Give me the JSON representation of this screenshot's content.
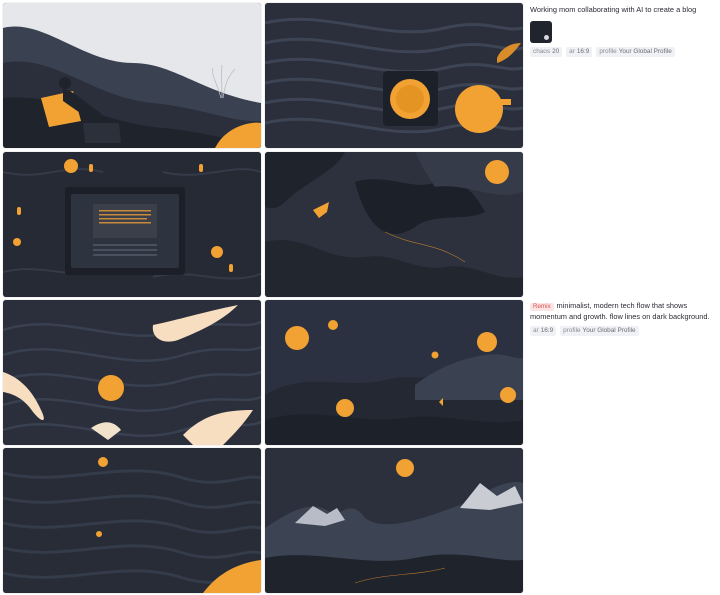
{
  "job1": {
    "prompt": "Working mom collaborating with AI to create a blog",
    "params": [
      {
        "key": "chaos",
        "value": "20"
      },
      {
        "key": "ar",
        "value": "16:9"
      },
      {
        "key": "profile",
        "value": "Your Global Profile"
      }
    ]
  },
  "job2": {
    "badge": "Remix",
    "prompt": "minimalist, modern tech flow that shows momentum and growth. flow lines on dark background.",
    "params": [
      {
        "key": "ar",
        "value": "16:9"
      },
      {
        "key": "profile",
        "value": "Your Global Profile"
      }
    ]
  },
  "colors": {
    "dark": "#2a2f3b",
    "accent": "#f2a233",
    "text": "#2a2c33"
  }
}
